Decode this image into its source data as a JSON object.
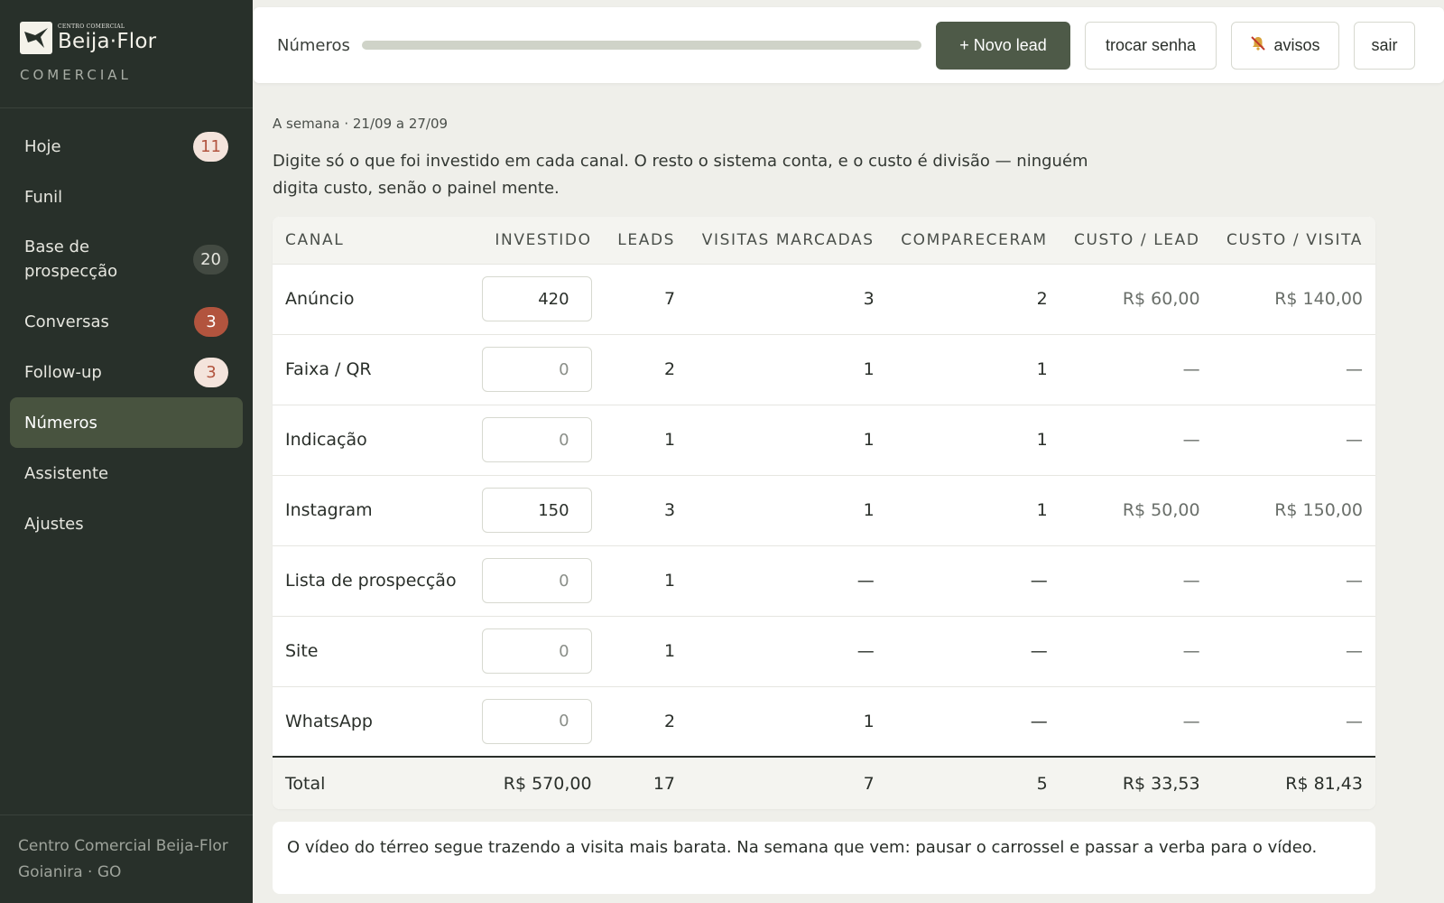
{
  "brand": {
    "small": "CENTRO COMERCIAL",
    "name": "Beija·Flor",
    "sub": "COMERCIAL"
  },
  "sidebar": {
    "items": [
      {
        "label": "Hoje",
        "badge": "11",
        "badge_style": "light"
      },
      {
        "label": "Funil",
        "badge": ""
      },
      {
        "label": "Base de prospecção",
        "badge": "20",
        "badge_style": "dark"
      },
      {
        "label": "Conversas",
        "badge": "3",
        "badge_style": "red"
      },
      {
        "label": "Follow-up",
        "badge": "3",
        "badge_style": "light"
      },
      {
        "label": "Números",
        "badge": "",
        "active": true
      },
      {
        "label": "Assistente",
        "badge": ""
      },
      {
        "label": "Ajustes",
        "badge": ""
      }
    ],
    "footer_line1": "Centro Comercial Beija-Flor",
    "footer_line2": "Goianira · GO"
  },
  "topbar": {
    "title": "Números",
    "new_lead": "+ Novo lead",
    "change_password": "trocar senha",
    "alerts": "avisos",
    "logout": "sair"
  },
  "main": {
    "week": "A semana · 21/09 a 27/09",
    "description": "Digite só o que foi investido em cada canal. O resto o sistema conta, e o custo é divisão — ninguém digita custo, senão o painel mente.",
    "table": {
      "headers": [
        "CANAL",
        "INVESTIDO",
        "LEADS",
        "VISITAS MARCADAS",
        "COMPARECERAM",
        "CUSTO / LEAD",
        "CUSTO / VISITA"
      ],
      "rows": [
        {
          "canal": "Anúncio",
          "investido": "420",
          "leads": "7",
          "visitas": "3",
          "compareceram": "2",
          "custo_lead": "R$ 60,00",
          "custo_visita": "R$ 140,00"
        },
        {
          "canal": "Faixa / QR",
          "investido": "0",
          "leads": "2",
          "visitas": "1",
          "compareceram": "1",
          "custo_lead": "—",
          "custo_visita": "—"
        },
        {
          "canal": "Indicação",
          "investido": "0",
          "leads": "1",
          "visitas": "1",
          "compareceram": "1",
          "custo_lead": "—",
          "custo_visita": "—"
        },
        {
          "canal": "Instagram",
          "investido": "150",
          "leads": "3",
          "visitas": "1",
          "compareceram": "1",
          "custo_lead": "R$ 50,00",
          "custo_visita": "R$ 150,00"
        },
        {
          "canal": "Lista de prospecção",
          "investido": "0",
          "leads": "1",
          "visitas": "—",
          "compareceram": "—",
          "custo_lead": "—",
          "custo_visita": "—"
        },
        {
          "canal": "Site",
          "investido": "0",
          "leads": "1",
          "visitas": "—",
          "compareceram": "—",
          "custo_lead": "—",
          "custo_visita": "—"
        },
        {
          "canal": "WhatsApp",
          "investido": "0",
          "leads": "2",
          "visitas": "1",
          "compareceram": "—",
          "custo_lead": "—",
          "custo_visita": "—"
        }
      ],
      "total": {
        "label": "Total",
        "investido": "R$ 570,00",
        "leads": "17",
        "visitas": "7",
        "compareceram": "5",
        "custo_lead": "R$ 33,53",
        "custo_visita": "R$ 81,43"
      }
    },
    "note": "O vídeo do térreo segue trazendo a visita mais barata. Na semana que vem: pausar o carrossel e passar a verba para o vídeo."
  },
  "colors": {
    "sidebar_bg": "#28302a",
    "active_nav": "#48533f",
    "primary_button": "#4e5a48",
    "badge_red": "#b2543e",
    "badge_light": "#f4e4dc"
  }
}
